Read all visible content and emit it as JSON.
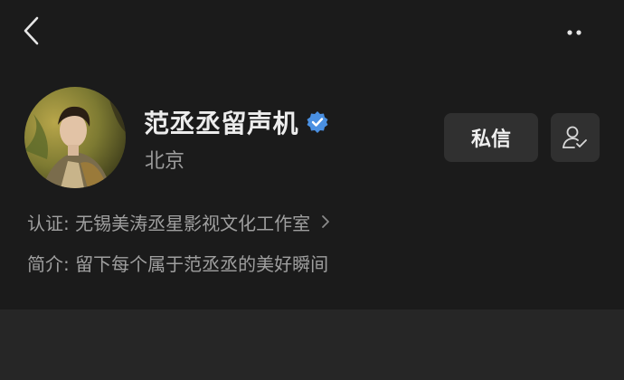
{
  "header": {
    "back_icon": "chevron-left-icon",
    "more_icon": "more-dots-icon"
  },
  "profile": {
    "name": "范丞丞留声机",
    "verified_icon": "verified-badge-icon",
    "verified_color": "#4a90e2",
    "location": "北京",
    "avatar_description_colors": {
      "background": "#8a8a3a",
      "accent": "#c9a93a"
    }
  },
  "actions": {
    "dm_label": "私信",
    "follow_icon": "user-check-icon"
  },
  "info": {
    "certification": "认证: 无锡美涛丞星影视文化工作室",
    "bio": "简介: 留下每个属于范丞丞的美好瞬间"
  },
  "colors": {
    "card_bg": "#1b1b1b",
    "page_bg": "#262626",
    "button_bg": "#303030",
    "primary_text": "#ececec",
    "secondary_text": "#9b9b9b"
  }
}
